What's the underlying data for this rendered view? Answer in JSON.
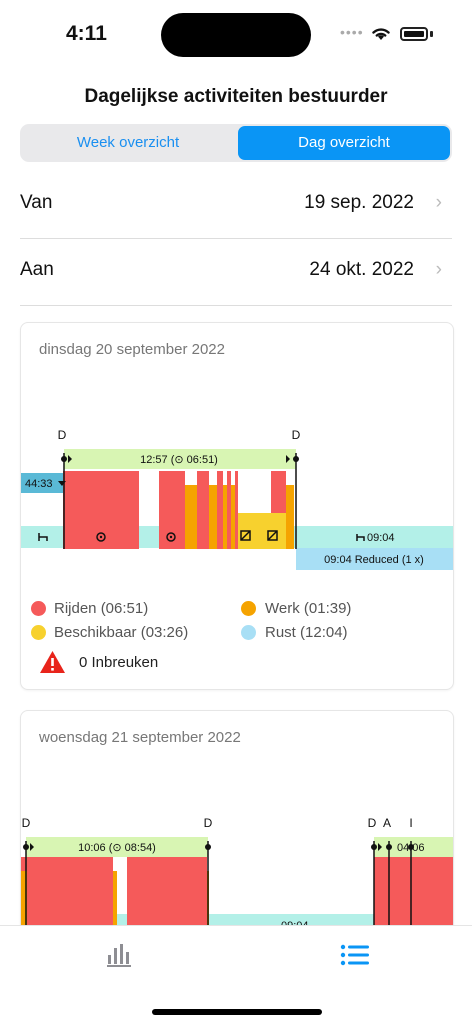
{
  "status": {
    "time": "4:11"
  },
  "title": "Dagelijkse activiteiten bestuurder",
  "segment": {
    "week": "Week overzicht",
    "day": "Dag overzicht"
  },
  "filters": [
    {
      "label": "Van",
      "value": "19 sep. 2022"
    },
    {
      "label": "Aan",
      "value": "24 okt. 2022"
    }
  ],
  "cards": [
    {
      "date": "dinsdag 20 september 2022",
      "d_left": "D",
      "d_right": "D",
      "shift_label": "12:57 (⊙ 06:51)",
      "left_tag": "44:33",
      "rest_label": "09:04",
      "reduced_label": "09:04 Reduced (1 x)",
      "legend": [
        {
          "label": "Rijden (06:51)",
          "color": "#f55a5a"
        },
        {
          "label": "Werk (01:39)",
          "color": "#f5a300"
        },
        {
          "label": "Beschikbaar (03:26)",
          "color": "#f7d12e"
        },
        {
          "label": "Rust (12:04)",
          "color": "#a8dff5"
        }
      ],
      "infractions": "0 Inbreuken"
    },
    {
      "date": "woensdag 21 september 2022",
      "d1": "D",
      "d2": "D",
      "d3": "D",
      "a_label": "A",
      "i_label": "I",
      "shift_label": "10:06 (⊙ 08:54)",
      "shift2_label": "04:06",
      "rest_label": "09:04"
    }
  ],
  "colors": {
    "driving": "#f55a5a",
    "work": "#f5a300",
    "available": "#f7d12e",
    "rest": "#b3f0e8",
    "shift": "#d8f5b3",
    "accent": "#0a95f5"
  },
  "tabs": [
    {
      "icon": "bar-chart-icon"
    },
    {
      "icon": "list-icon"
    }
  ]
}
